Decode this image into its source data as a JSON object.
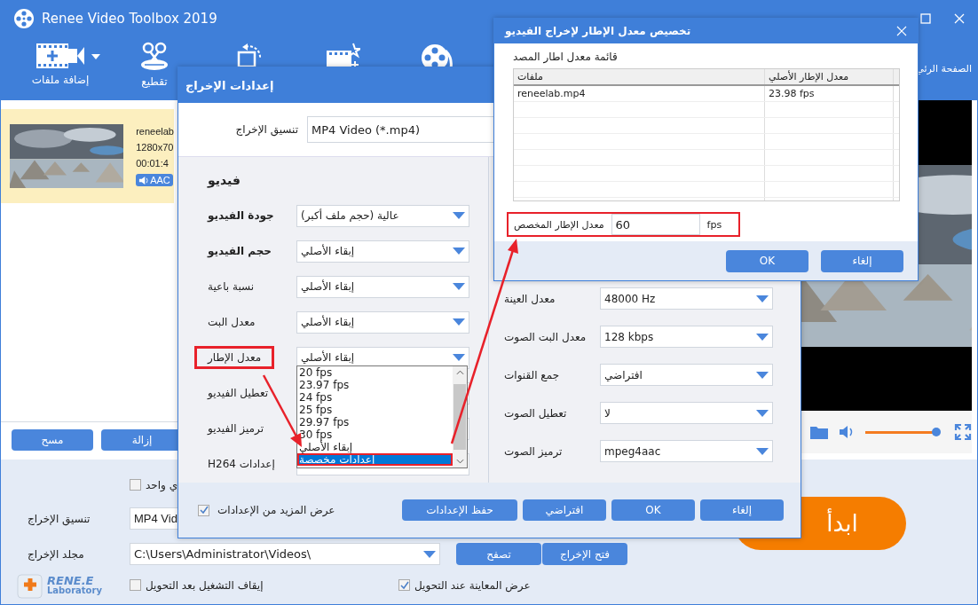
{
  "window": {
    "title": "Renee Video Toolbox 2019"
  },
  "toolbar": [
    {
      "kind": "reel"
    },
    {
      "kind": "effects"
    },
    {
      "kind": "rotate"
    },
    {
      "kind": "cut",
      "label": "تقطيع"
    },
    {
      "kind": "add",
      "label": "إضافة ملفات"
    }
  ],
  "home_tab": {
    "label": "الصفحة الرئي"
  },
  "file_item": {
    "name": "reneelab",
    "resolution": "1280x70",
    "duration": "00:01:4",
    "audio": "AAC",
    "selected": true
  },
  "list_buttons": [
    "إزالة",
    "مسح"
  ],
  "preview": {
    "volume": {
      "level": 0.98
    }
  },
  "bottom": {
    "merge": {
      "label": "ي واحد",
      "checked": false
    },
    "output_format": {
      "label": "تنسيق الإخراج",
      "value": "MP4 Vid"
    },
    "output_folder": {
      "label": "مجلد الإخراج",
      "value": "C:\\Users\\Administrator\\Videos\\"
    },
    "folder_buttons": [
      "فتح الإخراج",
      "تصفح"
    ],
    "options": [
      {
        "label": "عرض المعاينة عند التحويل",
        "checked": true
      },
      {
        "label": "إيقاف التشغيل بعد التحويل",
        "checked": false
      }
    ],
    "start": "ابدأ",
    "logo": {
      "name": "RENE.E",
      "sub": "Laboratory"
    }
  },
  "output_dialog": {
    "title": "إعدادات الإخراج",
    "format_label": "تنسيق الإخراج",
    "format_value": "MP4 Video (*.mp4)",
    "video_heading": "فيديو",
    "video_rows": [
      {
        "label": "جودة الفيديو",
        "bold": true,
        "value": "عالية (حجم ملف أكبر)",
        "highlighted": false
      },
      {
        "label": "حجم الفيديو",
        "bold": true,
        "value": "إبقاء الأصلي",
        "highlighted": false
      },
      {
        "label": "نسبة باعية",
        "bold": false,
        "value": "إبقاء الأصلي",
        "highlighted": false
      },
      {
        "label": "معدل البت",
        "bold": false,
        "value": "إبقاء الأصلي",
        "highlighted": false
      },
      {
        "label": "معدل الإطار",
        "bold": false,
        "value": "إبقاء الأصلي",
        "highlighted": true
      },
      {
        "label": "تعطيل الفيديو",
        "bold": false,
        "highlighted": false
      },
      {
        "label": "ترميز الفيديو",
        "bold": false,
        "highlighted": false
      },
      {
        "label": "H264 إعدادات",
        "bold": false,
        "highlighted": false
      }
    ],
    "dropdown_options": [
      {
        "label": "20 fps",
        "selected": false
      },
      {
        "label": "23.97 fps",
        "selected": false
      },
      {
        "label": "24 fps",
        "selected": false
      },
      {
        "label": "25 fps",
        "selected": false
      },
      {
        "label": "29.97 fps",
        "selected": false
      },
      {
        "label": "30 fps",
        "selected": false
      },
      {
        "label": "إبقاء الأصلي",
        "selected": false
      },
      {
        "label": "إعدادات مخصصة",
        "selected": true
      }
    ],
    "audio_rows": [
      {
        "label": "معدل العينة",
        "value": "48000 Hz"
      },
      {
        "label": "معدل البت الصوت",
        "value": "128 kbps"
      },
      {
        "label": "جمع القنوات",
        "value": "افتراضي"
      },
      {
        "label": "تعطيل الصوت",
        "value": "لا"
      },
      {
        "label": "ترميز الصوت",
        "value": "mpeg4aac"
      }
    ],
    "more_settings": {
      "label": "عرض المزيد من الإعدادات",
      "checked": true
    },
    "buttons": [
      "إلغاء",
      "OK",
      "افتراضي",
      "حفظ الإعدادات"
    ]
  },
  "custom_dialog": {
    "title": "تخصيص معدل الإطار لإخراج الفيديو",
    "list_label": "قائمة معدل اطار المصد",
    "table": {
      "columns": [
        "معدل الإطار الأصلي",
        "ملفات"
      ],
      "rows": [
        [
          "23.98 fps",
          "reneelab.mp4"
        ]
      ]
    },
    "custom_label": "معدل الإطار المخصص",
    "custom_value": "60",
    "unit": "fps",
    "highlighted": true,
    "buttons": [
      "إلغاء",
      "OK"
    ]
  }
}
